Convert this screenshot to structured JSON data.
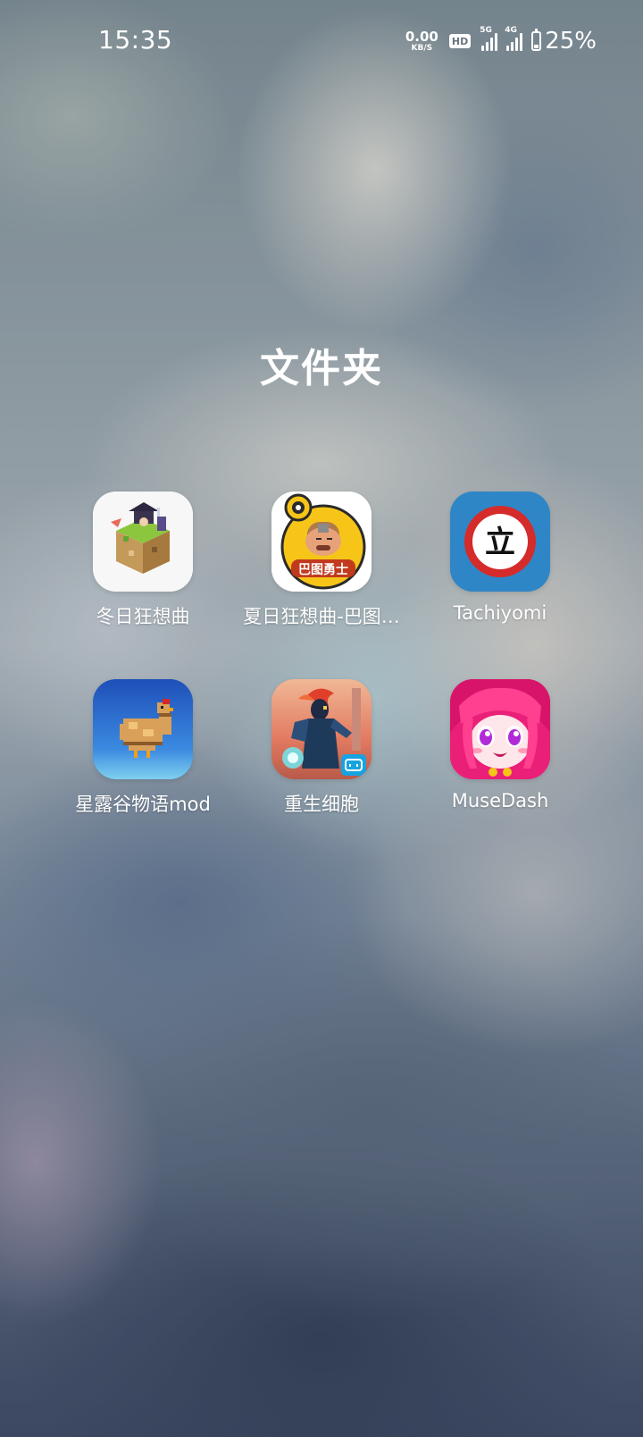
{
  "status_bar": {
    "time": "15:35",
    "net_speed_value": "0.00",
    "net_speed_unit": "KB/S",
    "hd_label": "HD",
    "signal_1_label": "5G",
    "signal_2_label": "4G",
    "battery_text": "25%",
    "battery_level": 0.25
  },
  "folder": {
    "title": "文件夹",
    "apps": [
      {
        "label": "冬日狂想曲",
        "icon": "winter-rhapsody-app-icon"
      },
      {
        "label": "夏日狂想曲-巴图…",
        "icon": "summer-rhapsody-app-icon",
        "icon_text": "巴图勇士"
      },
      {
        "label": "Tachiyomi",
        "icon": "tachiyomi-app-icon",
        "icon_text": "立"
      },
      {
        "label": "星露谷物语mod",
        "icon": "stardew-valley-app-icon"
      },
      {
        "label": "重生细胞",
        "icon": "dead-cells-app-icon"
      },
      {
        "label": "MuseDash",
        "icon": "muse-dash-app-icon"
      }
    ]
  },
  "colors": {
    "tachiyomi_blue": "#2f86c6",
    "tachiyomi_red": "#d52b2b",
    "summer_yellow": "#f7c518",
    "stardew_blue": "#2a6fd0",
    "musedash_pink": "#e8207a"
  }
}
